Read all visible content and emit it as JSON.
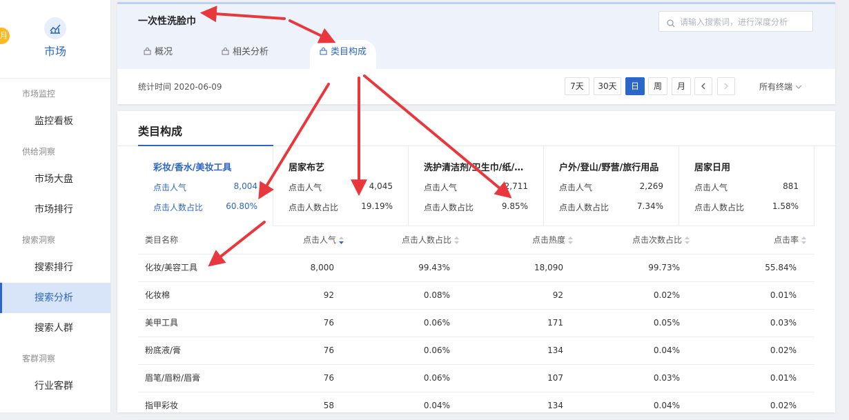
{
  "sidebar": {
    "badge": "月",
    "module_icon": "market-chart-icon",
    "module_title": "市场",
    "groups": {
      "monitor": "市场监控",
      "supply": "供给洞察",
      "search": "搜索洞察",
      "customer": "客群洞察"
    },
    "items": {
      "monitor_board": "监控看板",
      "market_overview": "市场大盘",
      "market_rank": "市场排行",
      "search_rank": "搜索排行",
      "search_analysis": "搜索分析",
      "search_crowd": "搜索人群",
      "industry_customer": "行业客群"
    }
  },
  "header": {
    "product_name": "一次性洗脸巾",
    "search_placeholder": "请输入搜索词，进行深度分析",
    "tabs": [
      "概况",
      "相关分析",
      "类目构成"
    ],
    "active_tab": "类目构成",
    "stat_time": "统计时间 2020-06-09",
    "range_buttons": [
      "7天",
      "30天",
      "日",
      "周",
      "月"
    ],
    "active_range": "日",
    "prev": "‹",
    "next": "›",
    "terminal": "所有终端"
  },
  "section": {
    "title": "类目构成"
  },
  "categories": [
    {
      "name": "彩妆/香水/美妆工具",
      "click_label": "点击人气",
      "click_value": "8,004",
      "ratio_label": "点击人数占比",
      "ratio_value": "60.80%"
    },
    {
      "name": "居家布艺",
      "click_label": "点击人气",
      "click_value": "4,045",
      "ratio_label": "点击人数占比",
      "ratio_value": "19.19%"
    },
    {
      "name": "洗护清洁剂/卫生巾/纸/香薰",
      "click_label": "点击人气",
      "click_value": "2,711",
      "ratio_label": "点击人数占比",
      "ratio_value": "9.85%"
    },
    {
      "name": "户外/登山/野营/旅行用品",
      "click_label": "点击人气",
      "click_value": "2,269",
      "ratio_label": "点击人数占比",
      "ratio_value": "7.34%"
    },
    {
      "name": "居家日用",
      "click_label": "点击人气",
      "click_value": "881",
      "ratio_label": "点击人数占比",
      "ratio_value": "1.58%"
    }
  ],
  "table": {
    "headers": [
      "类目名称",
      "点击人气",
      "点击人数占比",
      "点击热度",
      "点击次数占比",
      "点击率"
    ],
    "rows": [
      [
        "化妆/美容工具",
        "8,000",
        "99.43%",
        "18,090",
        "99.73%",
        "55.84%"
      ],
      [
        "化妆棉",
        "92",
        "0.08%",
        "92",
        "0.02%",
        "0.01%"
      ],
      [
        "美甲工具",
        "76",
        "0.06%",
        "171",
        "0.05%",
        "0.03%"
      ],
      [
        "粉底液/膏",
        "76",
        "0.06%",
        "134",
        "0.04%",
        "0.02%"
      ],
      [
        "眉笔/眉粉/眉膏",
        "76",
        "0.06%",
        "107",
        "0.03%",
        "0.01%"
      ],
      [
        "指甲彩妆",
        "58",
        "0.04%",
        "134",
        "0.04%",
        "0.02%"
      ]
    ]
  },
  "colors": {
    "accent": "#2b66c9",
    "annotation_arrow": "#e8383d",
    "badge": "#ffb824"
  }
}
